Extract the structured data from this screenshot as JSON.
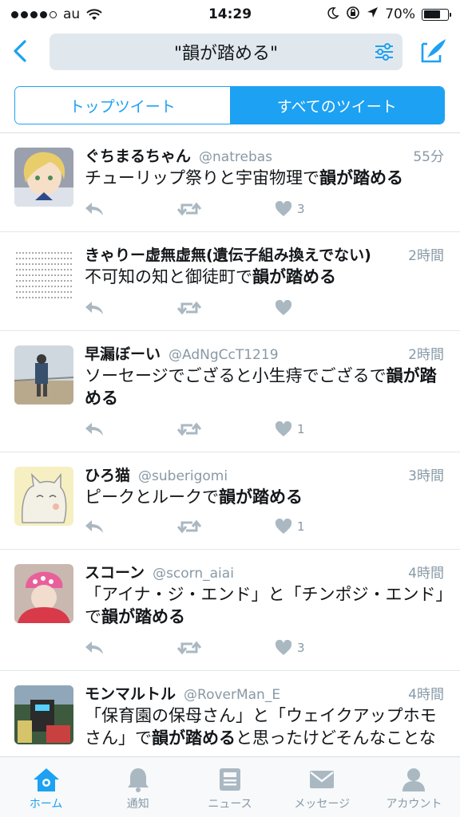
{
  "status_bar": {
    "carrier": "au",
    "time": "14:29",
    "battery": "70%",
    "battery_level": 0.7
  },
  "search": {
    "query": "\"韻が踏める\""
  },
  "segments": {
    "top": "トップツイート",
    "all": "すべてのツイート"
  },
  "tweets": [
    {
      "name": "ぐちまるちゃん",
      "handle": "@natrebas",
      "time": "55分",
      "text_plain": "チューリップ祭りと宇宙物理で",
      "text_bold": "韻が踏める",
      "text_after": "",
      "likes": "3"
    },
    {
      "name": "きゃりー虚無虚無(遺伝子組み換えでない)",
      "handle": "",
      "time": "2時間",
      "text_plain": "不可知の知と御徒町で",
      "text_bold": "韻が踏める",
      "text_after": "",
      "likes": ""
    },
    {
      "name": "早漏ぼーい",
      "handle": "@AdNgCcT1219",
      "time": "2時間",
      "text_plain": "ソーセージでござると小生痔でござるで",
      "text_bold": "韻が踏める",
      "text_after": "",
      "likes": "1"
    },
    {
      "name": "ひろ猫",
      "handle": "@suberigomi",
      "time": "3時間",
      "text_plain": "ピークとルークで",
      "text_bold": "韻が踏める",
      "text_after": "",
      "likes": "1"
    },
    {
      "name": "スコーン",
      "handle": "@scorn_aiai",
      "time": "4時間",
      "text_plain": "「アイナ・ジ・エンド」と「チンポジ・エンド」で",
      "text_bold": "韻が踏める",
      "text_after": "",
      "likes": "3"
    },
    {
      "name": "モンマルトル",
      "handle": "@RoverMan_E",
      "time": "4時間",
      "text_plain": "「保育園の保母さん」と「ウェイクアップホモさん」で",
      "text_bold": "韻が踏める",
      "text_after": "と思ったけどそんなことな",
      "likes": ""
    }
  ],
  "tabs": {
    "home": "ホーム",
    "notifications": "通知",
    "news": "ニュース",
    "messages": "メッセージ",
    "account": "アカウント"
  },
  "colors": {
    "accent": "#1da1f2",
    "muted": "#8899a6",
    "search_bg": "#e1e8ed"
  },
  "icons": [
    "back-arrow-icon",
    "filter-sliders-icon",
    "compose-tweet-icon",
    "reply-icon",
    "retweet-icon",
    "heart-icon",
    "home-icon",
    "bell-icon",
    "news-icon",
    "envelope-icon",
    "person-icon",
    "wifi-icon",
    "moon-icon",
    "rotation-lock-icon",
    "location-arrow-icon",
    "battery-icon"
  ]
}
